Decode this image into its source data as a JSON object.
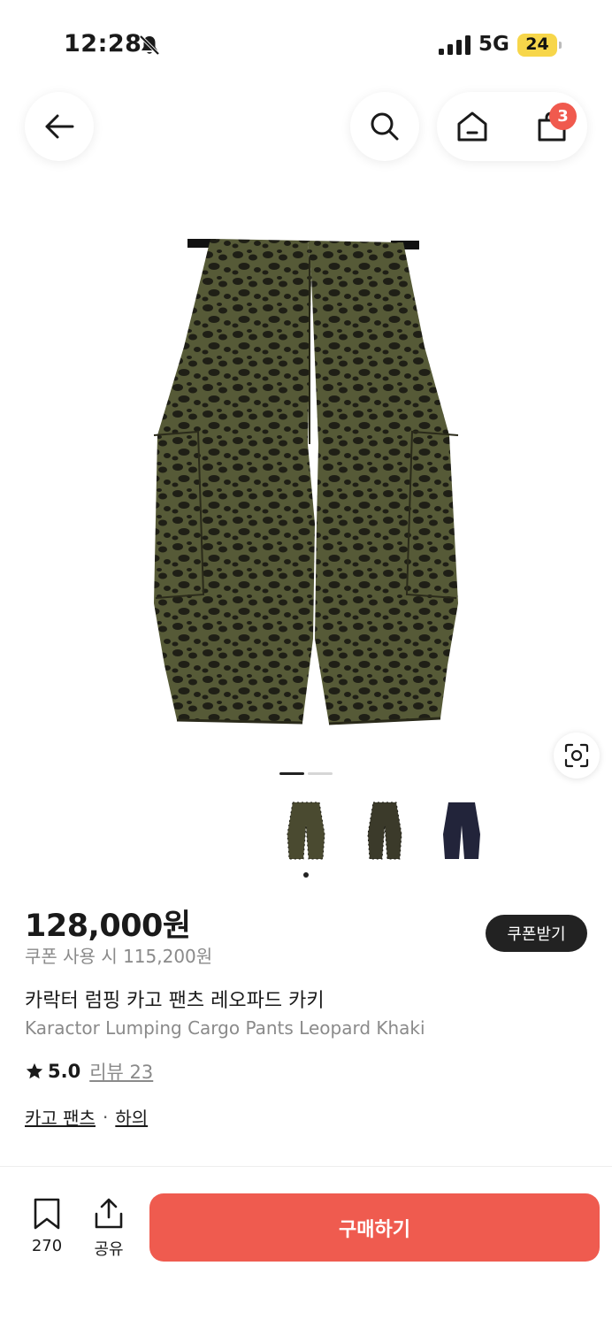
{
  "status_bar": {
    "time": "12:28",
    "network": "5G",
    "battery": "24",
    "icons": [
      "bell-off-icon",
      "signal-icon",
      "battery-icon"
    ]
  },
  "nav": {
    "back_icon": "arrow-left-icon",
    "search_icon": "search-icon",
    "home_icon": "home-icon",
    "cart_icon": "shopping-bag-icon",
    "cart_count": "3"
  },
  "gallery": {
    "image_index": 1,
    "image_count": 2,
    "lens_icon": "visual-search-icon",
    "color_options": [
      {
        "name": "leopard-khaki",
        "color": "#4a4a30",
        "selected": true
      },
      {
        "name": "leopard-dark",
        "color": "#3b3a2a",
        "selected": false
      },
      {
        "name": "navy",
        "color": "#22243a",
        "selected": false
      }
    ]
  },
  "product": {
    "price": "128,000원",
    "coupon_price": "쿠폰 사용 시 115,200원",
    "coupon_button": "쿠폰받기",
    "name_ko": "카락터 럼핑 카고 팬츠 레오파드 카키",
    "name_en": "Karactor Lumping Cargo Pants Leopard Khaki",
    "rating": "5.0",
    "review_label": "리뷰 23",
    "categories": [
      "카고 팬츠",
      "하의"
    ],
    "category_separator": "·"
  },
  "bottom_bar": {
    "like_count": "270",
    "share_label": "공유",
    "buy_label": "구매하기"
  },
  "colors": {
    "accent": "#ef5b4f",
    "badge": "#f05a4e",
    "dark": "#222222",
    "muted": "#8a8a8a"
  }
}
